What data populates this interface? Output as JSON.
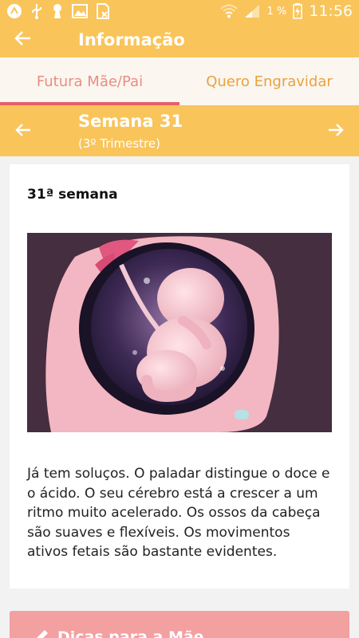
{
  "status_bar": {
    "battery_percent": "1 %",
    "time": "11:56",
    "icons": [
      "app-icon",
      "usb-icon",
      "keyhole-icon",
      "image-icon",
      "sim-off-icon",
      "wifi-icon",
      "signal-icon",
      "battery-charging-icon"
    ]
  },
  "app_bar": {
    "title": "Informação",
    "back_icon": "arrow-left-icon"
  },
  "tabs": [
    {
      "label": "Futura Mãe/Pai",
      "active": true
    },
    {
      "label": "Quero Engravidar",
      "active": false
    }
  ],
  "week": {
    "title": "Semana 31",
    "subtitle": "(3º Trimestre)"
  },
  "content": {
    "heading": "31ª semana",
    "image_icon": "fetus-in-womb-illustration",
    "text": "Já tem soluços. O paladar distingue o doce e o ácido. O seu cérebro está a crescer a um ritmo muito acelerado. Os ossos da cabeça são suaves e flexíveis. Os movimentos ativos fetais são bastante evidentes."
  },
  "tips_button": {
    "label": "Dicas para a Mãe",
    "icon": "pen-icon"
  },
  "colors": {
    "primary": "#f9c45a",
    "tab_bg": "#fbf6ef",
    "tab_active": "#e98d83",
    "tab_inactive": "#eaa23e",
    "indicator": "#e4606a",
    "button": "#f3a0a1"
  }
}
